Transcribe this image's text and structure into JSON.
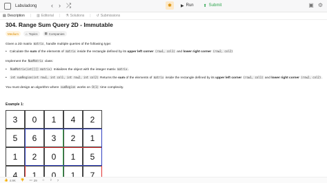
{
  "topbar": {
    "brand": "Labuladong",
    "run_label": "Run",
    "submit_label": "Submit"
  },
  "tabs": [
    {
      "label": "Description",
      "active": true
    },
    {
      "label": "Editorial",
      "active": false
    },
    {
      "label": "Solutions",
      "active": false
    },
    {
      "label": "Submissions",
      "active": false
    }
  ],
  "problem": {
    "title": "304. Range Sum Query 2D - Immutable",
    "difficulty": "Medium",
    "tags": [
      "Topics",
      "Companies"
    ],
    "intro_before": "Given a 2D matrix ",
    "intro_code": "matrix",
    "intro_after": ", handle multiple queries of the following type:",
    "item1_text1": "Calculate the ",
    "item1_bold1": "sum",
    "item1_text2": " of the elements of ",
    "item1_code1": "matrix",
    "item1_text3": " inside the rectangle defined by its ",
    "item1_bold2": "upper left corner",
    "item1_code2": "(row1, col1)",
    "item1_text4": " and ",
    "item1_bold3": "lower right corner",
    "item1_code3": "(row2, col2)",
    "impl_before": "Implement the ",
    "impl_code": "NumMatrix",
    "impl_after": " class:",
    "m1_code": "NumMatrix(int[][] matrix)",
    "m1_text": " Initializes the object with the integer matrix ",
    "m1_code2": "matrix",
    "m2_code": "int sumRegion(int row1, int col1, int row2, int col2)",
    "m2_text1": " Returns the ",
    "m2_bold1": "sum",
    "m2_text2": " of the elements of ",
    "m2_code2": "matrix",
    "m2_text3": " inside the rectangle defined by its ",
    "m2_bold2": "upper left corner",
    "m2_code3": "(row1, col1)",
    "m2_text4": " and ",
    "m2_bold3": "lower right corner",
    "m2_code4": "(row2, col2)",
    "design_before": "You must design an algorithm where ",
    "design_code1": "sumRegion",
    "design_mid": " works on ",
    "design_code2": "O(1)",
    "design_after": " time complexity.",
    "example_title": "Example 1:"
  },
  "matrix": [
    [
      "3",
      "0",
      "1",
      "4",
      "2"
    ],
    [
      "5",
      "6",
      "3",
      "2",
      "1"
    ],
    [
      "1",
      "2",
      "0",
      "1",
      "5"
    ],
    [
      "4",
      "1",
      "0",
      "1",
      "7"
    ]
  ],
  "colors": {
    "green": "#37b24d",
    "red": "#e03131",
    "blue": "#2f3fbf",
    "submit": "#2aa34a",
    "medium": "#d98a00"
  },
  "bottombar": {
    "likes": "4.9K",
    "comments": "29"
  }
}
